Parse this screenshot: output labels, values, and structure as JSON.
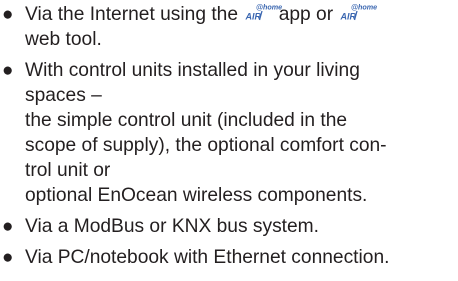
{
  "items": [
    {
      "lines": [
        {
          "before": "Via the Internet using the",
          "middle": "app or",
          "after": ""
        },
        {
          "text": "web tool."
        }
      ]
    },
    {
      "lines": [
        {
          "text": "With control units installed in your living"
        },
        {
          "text": "spaces –"
        },
        {
          "text": "the simple control unit (included in the"
        },
        {
          "text": "scope of supply), the optional comfort con-"
        },
        {
          "text": "trol unit or"
        },
        {
          "text": "optional EnOcean wireless components."
        }
      ]
    },
    {
      "lines": [
        {
          "text": "Via a ModBus or KNX bus system."
        }
      ]
    },
    {
      "lines": [
        {
          "text": "Via PC/notebook with Ethernet connection."
        }
      ]
    }
  ],
  "bullet_char": "●",
  "logo": {
    "brand_text": "AIR",
    "sup_text": "@home",
    "color": "#3b67b1"
  }
}
